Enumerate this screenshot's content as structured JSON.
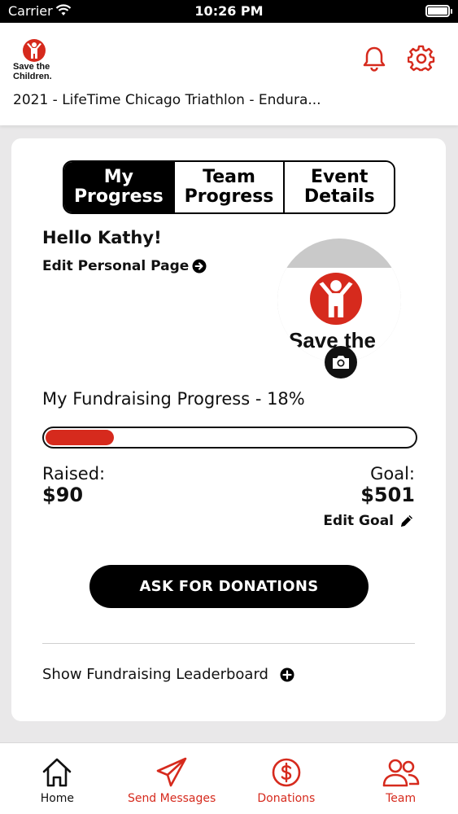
{
  "status_bar": {
    "carrier": "Carrier",
    "time": "10:26 PM"
  },
  "header": {
    "logo_text_line1": "Save the",
    "logo_text_line2": "Children.",
    "event_title": "2021 - LifeTime Chicago Triathlon - Endura..."
  },
  "tabs": [
    {
      "label": "My\nProgress",
      "active": true
    },
    {
      "label": "Team\nProgress",
      "active": false
    },
    {
      "label": "Event\nDetails",
      "active": false
    }
  ],
  "profile": {
    "greeting": "Hello Kathy!",
    "edit_page_label": "Edit Personal Page",
    "avatar_text": "Save the"
  },
  "fundraising": {
    "progress_title": "My Fundraising Progress - 18%",
    "progress_fraction": 0.18,
    "raised_label": "Raised:",
    "raised_value": "$90",
    "goal_label": "Goal:",
    "goal_value": "$501",
    "edit_goal_label": "Edit Goal"
  },
  "ask_button_label": "ASK FOR DONATIONS",
  "leaderboard_label": "Show Fundraising Leaderboard",
  "tabbar": {
    "home": "Home",
    "messages": "Send Messages",
    "donations": "Donations",
    "team": "Team"
  },
  "colors": {
    "brand_red": "#d62a1d",
    "black": "#000000"
  }
}
